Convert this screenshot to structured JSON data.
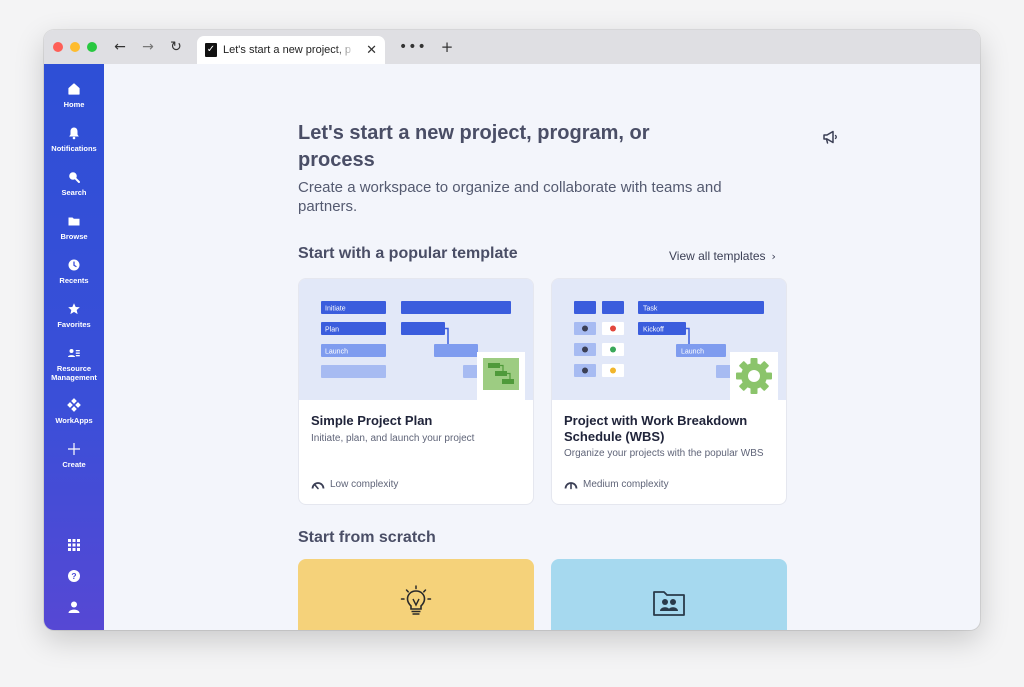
{
  "browser": {
    "tab_title": "Let's start a new project, p",
    "favicon_glyph": "✓",
    "back_icon": "←",
    "forward_icon": "→",
    "reload_icon": "↻",
    "close_icon": "✕",
    "more_icon": "•••",
    "new_tab_icon": "+"
  },
  "sidebar": {
    "items": [
      {
        "label": "Home",
        "icon": "home-icon"
      },
      {
        "label": "Notifications",
        "icon": "bell-icon"
      },
      {
        "label": "Search",
        "icon": "search-icon"
      },
      {
        "label": "Browse",
        "icon": "folder-icon"
      },
      {
        "label": "Recents",
        "icon": "clock-icon"
      },
      {
        "label": "Favorites",
        "icon": "star-icon"
      },
      {
        "label": "Resource Management",
        "icon": "people-icon"
      },
      {
        "label": "WorkApps",
        "icon": "workapps-icon"
      },
      {
        "label": "Create",
        "icon": "plus-icon"
      }
    ],
    "bottom_icons": [
      "apps-grid-icon",
      "help-icon",
      "account-icon"
    ]
  },
  "main": {
    "heading": "Let's start a new project, program, or process",
    "subtitle": "Create a workspace to organize and collaborate with teams and partners.",
    "popular_section_title": "Start with a popular template",
    "view_all_label": "View all templates",
    "view_all_chevron": "›",
    "templates": [
      {
        "title": "Simple Project Plan",
        "description": "Initiate, plan, and launch your project",
        "complexity": "Low complexity",
        "art_labels": [
          "Initiate",
          "Plan",
          "Launch"
        ]
      },
      {
        "title": "Project with Work Breakdown Schedule (WBS)",
        "description": "Organize your projects with the popular WBS",
        "complexity": "Medium complexity",
        "art_labels": [
          "Task",
          "Kickoff",
          "Launch"
        ]
      }
    ],
    "scratch_section_title": "Start from scratch",
    "scratch_cards": [
      {
        "icon": "lightbulb-icon",
        "color": "#f5d27a"
      },
      {
        "icon": "shared-folder-icon",
        "color": "#a6d9ef"
      }
    ]
  },
  "colors": {
    "sidebar_top": "#2e4fd6",
    "sidebar_bottom": "#5648d4",
    "accent_blue": "#3b5ddd",
    "light_blue": "#7f9cef",
    "template_art_bg": "#e2e8f8",
    "scratch_yellow": "#f5d27a",
    "scratch_blue": "#a6d9ef"
  }
}
